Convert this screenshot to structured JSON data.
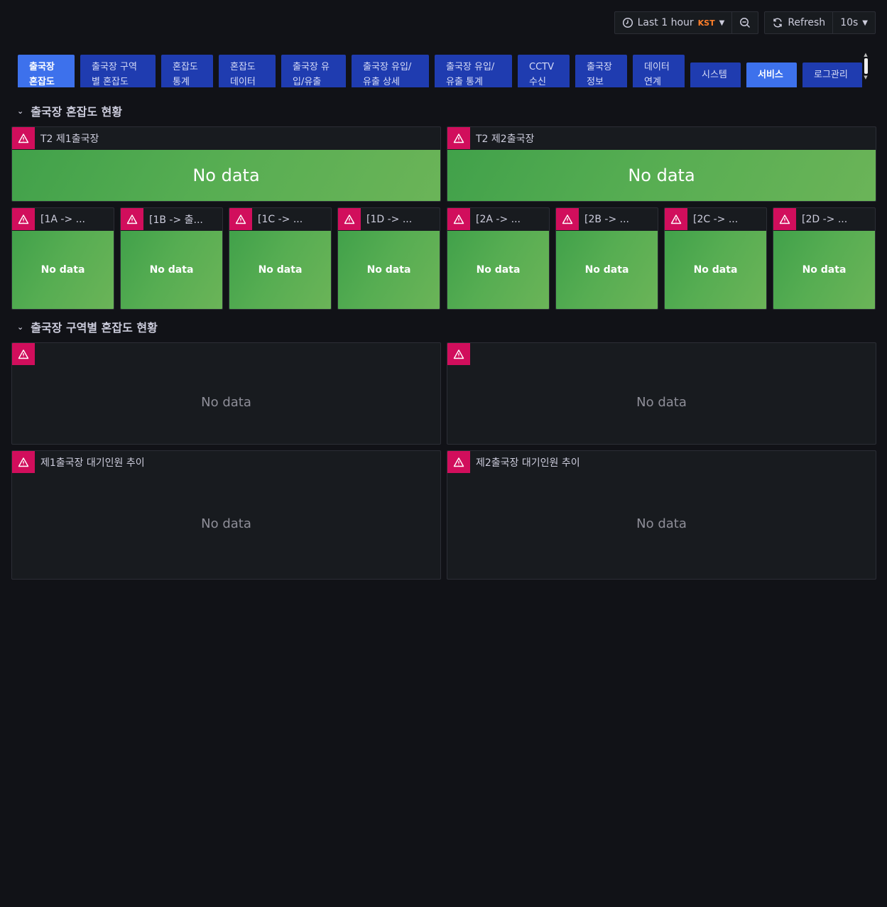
{
  "toolbar": {
    "time_range": "Last 1 hour",
    "timezone": "KST",
    "refresh_label": "Refresh",
    "refresh_interval": "10s"
  },
  "tabs": [
    {
      "line1": "출국장",
      "line2": "혼잡도",
      "active": true
    },
    {
      "line1": "출국장 구역",
      "line2": "별 혼잡도"
    },
    {
      "line1": "혼잡도",
      "line2": "통계"
    },
    {
      "line1": "혼잡도",
      "line2": "데이터"
    },
    {
      "line1": "출국장 유",
      "line2": "입/유출"
    },
    {
      "line1": "출국장 유입/",
      "line2": "유출 상세"
    },
    {
      "line1": "출국장 유입/",
      "line2": "유출 통계"
    },
    {
      "line1": "CCTV",
      "line2": "수신"
    },
    {
      "line1": "출국장",
      "line2": "정보"
    },
    {
      "line1": "데이터",
      "line2": "연계"
    },
    {
      "line1": "시스템"
    },
    {
      "line1": "서비스",
      "active": true
    },
    {
      "line1": "로그관리"
    }
  ],
  "rows": {
    "row1_title": "출국장 혼잡도 현황",
    "row2_title": "출국장 구역별 혼잡도 현황"
  },
  "terminal_panels": [
    {
      "title": "T2 제1출국장",
      "value": "No data"
    },
    {
      "title": "T2 제2출국장",
      "value": "No data"
    }
  ],
  "zone_panels": [
    {
      "title": "[1A -> ...",
      "value": "No data"
    },
    {
      "title": "[1B -> 출...",
      "value": "No data"
    },
    {
      "title": "[1C -> ...",
      "value": "No data"
    },
    {
      "title": "[1D -> ...",
      "value": "No data"
    },
    {
      "title": "[2A -> ...",
      "value": "No data"
    },
    {
      "title": "[2B -> ...",
      "value": "No data"
    },
    {
      "title": "[2C -> ...",
      "value": "No data"
    },
    {
      "title": "[2D -> ...",
      "value": "No data"
    }
  ],
  "area_panels": [
    {
      "title": "",
      "value": "No data"
    },
    {
      "title": "",
      "value": "No data"
    }
  ],
  "trend_panels": [
    {
      "title": "제1출국장 대기인원 추이",
      "value": "No data"
    },
    {
      "title": "제2출국장 대기인원 추이",
      "value": "No data"
    }
  ],
  "colors": {
    "warning": "#d10e5c",
    "stat_green": "#56ad52",
    "tab_blue": "#1f3cb0",
    "tab_active": "#3d71ec"
  }
}
